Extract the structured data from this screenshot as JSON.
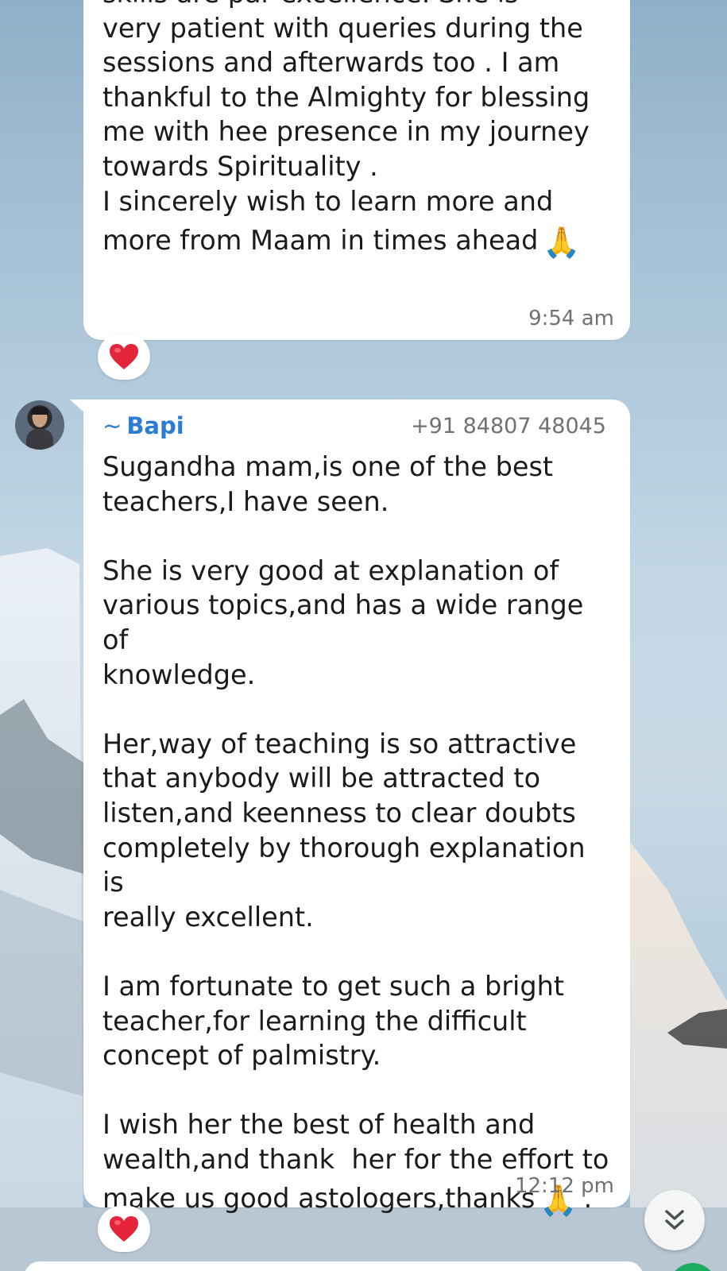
{
  "chat": {
    "message_1": {
      "lines": [
        "skills are par excellence. She is",
        "very patient with queries during the",
        "sessions and afterwards too . I am",
        "thankful to the Almighty for blessing",
        "me with hee presence in my journey",
        "towards Spirituality .",
        "I sincerely wish to learn more and"
      ],
      "last_line": "more from Maam in times ahead",
      "emoji": "🙏",
      "time": "9:54 am",
      "reaction": "❤️"
    },
    "message_2": {
      "sender_prefix": "~",
      "sender_name": "Bapi",
      "sender_phone": "+91 84807 48045",
      "paragraphs": [
        "Sugandha mam,is one of the best\nteachers,I have seen.",
        "She is very good at explanation of\nvarious topics,and has a wide range of\nknowledge.",
        "Her,way of teaching is so attractive\nthat anybody will be attracted to\nlisten,and keenness to clear doubts\ncompletely by thorough explanation is\nreally excellent.",
        "I am fortunate to get such a bright\nteacher,for learning the difficult\nconcept of palmistry.",
        "I wish her the best of health and\nwealth,and thank  her for the effort to"
      ],
      "last_line": "make us good astologers,thanks",
      "emoji": "🙏",
      "trailing": ".",
      "time": "12:12 pm",
      "reaction": "❤️"
    }
  },
  "icons": {
    "reaction": "heart-icon",
    "scroll": "double-chevron-down-icon",
    "avatar": "contact-avatar"
  },
  "colors": {
    "sender_name": "#2a7dd2",
    "bubble": "#ffffff",
    "time": "#6d7276",
    "heart": "#e3243b"
  }
}
